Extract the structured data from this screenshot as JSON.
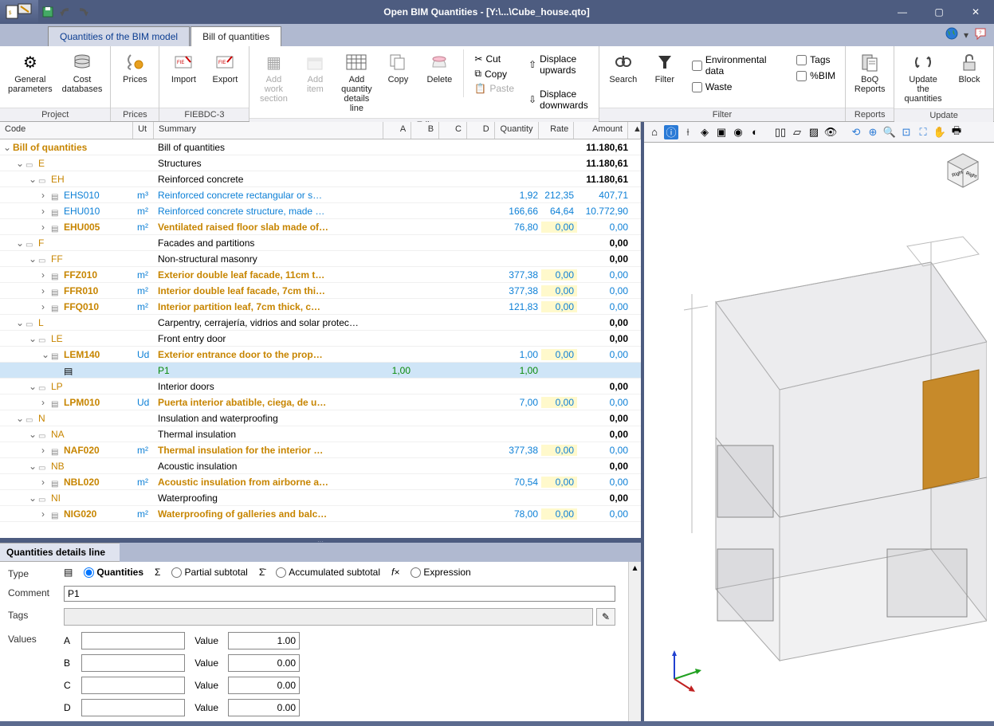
{
  "title": "Open BIM Quantities - [Y:\\...\\Cube_house.qto]",
  "tabs": {
    "model": "Quantities of the BIM model",
    "boq": "Bill of quantities"
  },
  "ribbon": {
    "project": {
      "label": "Project",
      "general": "General\nparameters",
      "cost": "Cost\ndatabases"
    },
    "prices": {
      "label": "Prices",
      "prices": "Prices"
    },
    "fiebdc": {
      "label": "FIEBDC-3",
      "import": "Import",
      "export": "Export"
    },
    "edit": {
      "label": "Edit",
      "addwork": "Add work\nsection",
      "additem": "Add\nitem",
      "addqty": "Add quantity\ndetails line",
      "copy": "Copy",
      "delete": "Delete",
      "cut": "Cut",
      "copy2": "Copy",
      "paste": "Paste",
      "disp_up": "Displace upwards",
      "disp_dn": "Displace downwards"
    },
    "filter": {
      "label": "Filter",
      "search": "Search",
      "filter": "Filter",
      "env": "Environmental data",
      "waste": "Waste",
      "tags": "Tags",
      "bim": "%BIM"
    },
    "reports": {
      "label": "Reports",
      "boqreports": "BoQ\nReports"
    },
    "update": {
      "label": "Update",
      "upd": "Update the\nquantities",
      "block": "Block"
    }
  },
  "headers": {
    "code": "Code",
    "ut": "Ut",
    "summary": "Summary",
    "a": "A",
    "b": "B",
    "c": "C",
    "d": "D",
    "qty": "Quantity",
    "rate": "Rate",
    "amount": "Amount"
  },
  "rows": [
    {
      "indent": 0,
      "exp": "open",
      "icon": "",
      "code": "Bill of quantities",
      "codeCls": "orange-bold",
      "ut": "",
      "sum": "Bill of quantities",
      "amt": "11.180,61",
      "amtCls": "bold"
    },
    {
      "indent": 1,
      "exp": "open",
      "icon": "folder",
      "code": "E",
      "codeCls": "orange",
      "ut": "",
      "sum": "Structures",
      "amt": "11.180,61",
      "amtCls": "bold"
    },
    {
      "indent": 2,
      "exp": "open",
      "icon": "folder",
      "code": "EH",
      "codeCls": "orange",
      "ut": "",
      "sum": "Reinforced concrete",
      "amt": "11.180,61",
      "amtCls": "bold"
    },
    {
      "indent": 3,
      "exp": "closed",
      "icon": "item",
      "code": "EHS010",
      "codeCls": "blue",
      "ut": "m³",
      "sum": "Reinforced concrete rectangular or s…",
      "sumCls": "blue",
      "qty": "1,92",
      "qtyCls": "blue",
      "rate": "212,35",
      "rateCls": "blue",
      "amt": "407,71",
      "amtCls": "blue"
    },
    {
      "indent": 3,
      "exp": "closed",
      "icon": "item",
      "code": "EHU010",
      "codeCls": "blue",
      "ut": "m²",
      "sum": "Reinforced concrete structure, made …",
      "sumCls": "blue",
      "qty": "166,66",
      "qtyCls": "blue",
      "rate": "64,64",
      "rateCls": "blue",
      "amt": "10.772,90",
      "amtCls": "blue"
    },
    {
      "indent": 3,
      "exp": "closed",
      "icon": "item",
      "code": "EHU005",
      "codeCls": "orange-bold",
      "ut": "m²",
      "sum": "Ventilated raised floor slab made of…",
      "sumCls": "orange-bold",
      "qty": "76,80",
      "qtyCls": "blue",
      "rate": "0,00",
      "rateCls": "blue yellow-bg",
      "amt": "0,00",
      "amtCls": "blue"
    },
    {
      "indent": 1,
      "exp": "open",
      "icon": "folder",
      "code": "F",
      "codeCls": "orange",
      "ut": "",
      "sum": "Facades and partitions",
      "amt": "0,00",
      "amtCls": "bold"
    },
    {
      "indent": 2,
      "exp": "open",
      "icon": "folder",
      "code": "FF",
      "codeCls": "orange",
      "ut": "",
      "sum": "Non-structural masonry",
      "amt": "0,00",
      "amtCls": "bold"
    },
    {
      "indent": 3,
      "exp": "closed",
      "icon": "item",
      "code": "FFZ010",
      "codeCls": "orange-bold",
      "ut": "m²",
      "sum": "Exterior double leaf facade, 11cm t…",
      "sumCls": "orange-bold",
      "qty": "377,38",
      "qtyCls": "blue",
      "rate": "0,00",
      "rateCls": "blue yellow-bg",
      "amt": "0,00",
      "amtCls": "blue"
    },
    {
      "indent": 3,
      "exp": "closed",
      "icon": "item",
      "code": "FFR010",
      "codeCls": "orange-bold",
      "ut": "m²",
      "sum": "Interior double leaf facade, 7cm thi…",
      "sumCls": "orange-bold",
      "qty": "377,38",
      "qtyCls": "blue",
      "rate": "0,00",
      "rateCls": "blue yellow-bg",
      "amt": "0,00",
      "amtCls": "blue"
    },
    {
      "indent": 3,
      "exp": "closed",
      "icon": "item",
      "code": "FFQ010",
      "codeCls": "orange-bold",
      "ut": "m²",
      "sum": "Interior partition leaf, 7cm thick, c…",
      "sumCls": "orange-bold",
      "qty": "121,83",
      "qtyCls": "blue",
      "rate": "0,00",
      "rateCls": "blue yellow-bg",
      "amt": "0,00",
      "amtCls": "blue"
    },
    {
      "indent": 1,
      "exp": "open",
      "icon": "folder",
      "code": "L",
      "codeCls": "orange",
      "ut": "",
      "sum": "Carpentry, cerrajería, vidrios and solar protec…",
      "amt": "0,00",
      "amtCls": "bold"
    },
    {
      "indent": 2,
      "exp": "open",
      "icon": "folder",
      "code": "LE",
      "codeCls": "orange",
      "ut": "",
      "sum": "Front entry door",
      "amt": "0,00",
      "amtCls": "bold"
    },
    {
      "indent": 3,
      "exp": "open",
      "icon": "item",
      "code": "LEM140",
      "codeCls": "orange-bold",
      "ut": "Ud",
      "sum": "Exterior entrance door to the prop…",
      "sumCls": "orange-bold",
      "qty": "1,00",
      "qtyCls": "blue",
      "rate": "0,00",
      "rateCls": "blue yellow-bg",
      "amt": "0,00",
      "amtCls": "blue"
    },
    {
      "indent": 4,
      "exp": "",
      "icon": "leaf",
      "code": "",
      "ut": "",
      "sum": "P1",
      "sumCls": "green",
      "a": "1,00",
      "aCls": "green",
      "qty": "1,00",
      "qtyCls": "green",
      "selected": true
    },
    {
      "indent": 2,
      "exp": "open",
      "icon": "folder",
      "code": "LP",
      "codeCls": "orange",
      "ut": "",
      "sum": "Interior doors",
      "amt": "0,00",
      "amtCls": "bold"
    },
    {
      "indent": 3,
      "exp": "closed",
      "icon": "item",
      "code": "LPM010",
      "codeCls": "orange-bold",
      "ut": "Ud",
      "sum": "Puerta interior abatible, ciega, de u…",
      "sumCls": "orange-bold",
      "qty": "7,00",
      "qtyCls": "blue",
      "rate": "0,00",
      "rateCls": "blue yellow-bg",
      "amt": "0,00",
      "amtCls": "blue"
    },
    {
      "indent": 1,
      "exp": "open",
      "icon": "folder",
      "code": "N",
      "codeCls": "orange",
      "ut": "",
      "sum": "Insulation and waterproofing",
      "amt": "0,00",
      "amtCls": "bold"
    },
    {
      "indent": 2,
      "exp": "open",
      "icon": "folder",
      "code": "NA",
      "codeCls": "orange",
      "ut": "",
      "sum": "Thermal insulation",
      "amt": "0,00",
      "amtCls": "bold"
    },
    {
      "indent": 3,
      "exp": "closed",
      "icon": "item",
      "code": "NAF020",
      "codeCls": "orange-bold",
      "ut": "m²",
      "sum": "Thermal insulation for the interior …",
      "sumCls": "orange-bold",
      "qty": "377,38",
      "qtyCls": "blue",
      "rate": "0,00",
      "rateCls": "blue yellow-bg",
      "amt": "0,00",
      "amtCls": "blue"
    },
    {
      "indent": 2,
      "exp": "open",
      "icon": "folder",
      "code": "NB",
      "codeCls": "orange",
      "ut": "",
      "sum": "Acoustic insulation",
      "amt": "0,00",
      "amtCls": "bold"
    },
    {
      "indent": 3,
      "exp": "closed",
      "icon": "item",
      "code": "NBL020",
      "codeCls": "orange-bold",
      "ut": "m²",
      "sum": "Acoustic insulation from airborne a…",
      "sumCls": "orange-bold",
      "qty": "70,54",
      "qtyCls": "blue",
      "rate": "0,00",
      "rateCls": "blue yellow-bg",
      "amt": "0,00",
      "amtCls": "blue"
    },
    {
      "indent": 2,
      "exp": "open",
      "icon": "folder",
      "code": "NI",
      "codeCls": "orange",
      "ut": "",
      "sum": "Waterproofing",
      "amt": "0,00",
      "amtCls": "bold"
    },
    {
      "indent": 3,
      "exp": "closed",
      "icon": "item",
      "code": "NIG020",
      "codeCls": "orange-bold",
      "ut": "m²",
      "sum": "Waterproofing of galleries and balc…",
      "sumCls": "orange-bold",
      "qty": "78,00",
      "qtyCls": "blue",
      "rate": "0,00",
      "rateCls": "blue yellow-bg",
      "amt": "0,00",
      "amtCls": "blue"
    }
  ],
  "details": {
    "panel": "Quantities details line",
    "type": "Type",
    "quantities": "Quantities",
    "partial": "Partial subtotal",
    "accum": "Accumulated subtotal",
    "expr": "Expression",
    "comment": "Comment",
    "comment_val": "P1",
    "tags": "Tags",
    "values": "Values",
    "labels": [
      "A",
      "B",
      "C",
      "D"
    ],
    "vals": [
      "1.00",
      "0.00",
      "0.00",
      "0.00"
    ],
    "value_lbl": "Value"
  }
}
